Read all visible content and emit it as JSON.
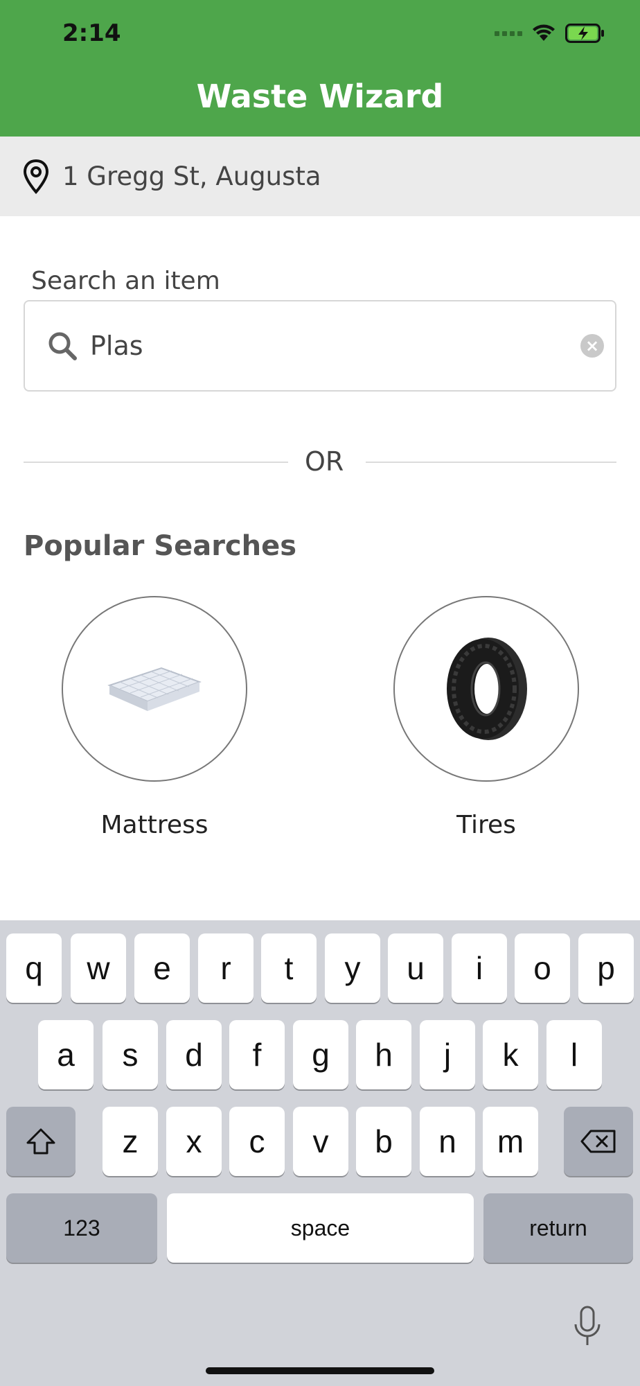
{
  "status_bar": {
    "time": "2:14"
  },
  "header": {
    "title": "Waste Wizard"
  },
  "location": {
    "address": "1 Gregg St, Augusta"
  },
  "search": {
    "label": "Search an item",
    "value": "Plas"
  },
  "divider": {
    "text": "OR"
  },
  "popular": {
    "title": "Popular Searches",
    "items": [
      {
        "label": "Mattress"
      },
      {
        "label": "Tires"
      }
    ]
  },
  "keyboard": {
    "row1": [
      "q",
      "w",
      "e",
      "r",
      "t",
      "y",
      "u",
      "i",
      "o",
      "p"
    ],
    "row2": [
      "a",
      "s",
      "d",
      "f",
      "g",
      "h",
      "j",
      "k",
      "l"
    ],
    "row3": [
      "z",
      "x",
      "c",
      "v",
      "b",
      "n",
      "m"
    ],
    "numbers_label": "123",
    "space_label": "space",
    "return_label": "return"
  },
  "colors": {
    "header_green": "#4ea64b",
    "location_bg": "#ebebeb",
    "keyboard_bg": "#d1d3d9"
  }
}
